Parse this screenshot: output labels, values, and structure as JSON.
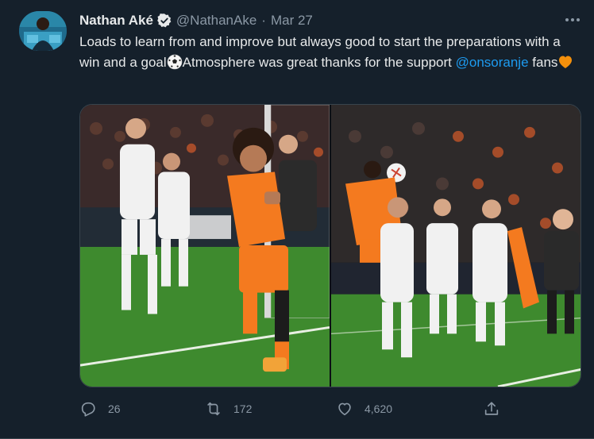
{
  "tweet": {
    "author_name": "Nathan Aké",
    "author_handle": "@NathanAke",
    "separator": "·",
    "date": "Mar 27",
    "text_part1": "Loads to learn from and improve but always good to start the preparations with a win and a goal",
    "text_part2": "Atmosphere was great thanks for the support ",
    "mention": "@onsoranje",
    "text_part3": " fans",
    "emoji_1": "soccer-ball",
    "emoji_2": "orange-heart"
  },
  "stats": {
    "replies": "26",
    "retweets": "172",
    "likes": "4,620"
  },
  "colors": {
    "background": "#15202b",
    "text": "#e7e9ea",
    "secondary": "#8b98a5",
    "link": "#1d9bf0",
    "verified": "#1d9bf0",
    "netherlands_orange": "#f47a1f",
    "denmark_white": "#f1f1f1",
    "pitch_green": "#3e8a2e"
  }
}
